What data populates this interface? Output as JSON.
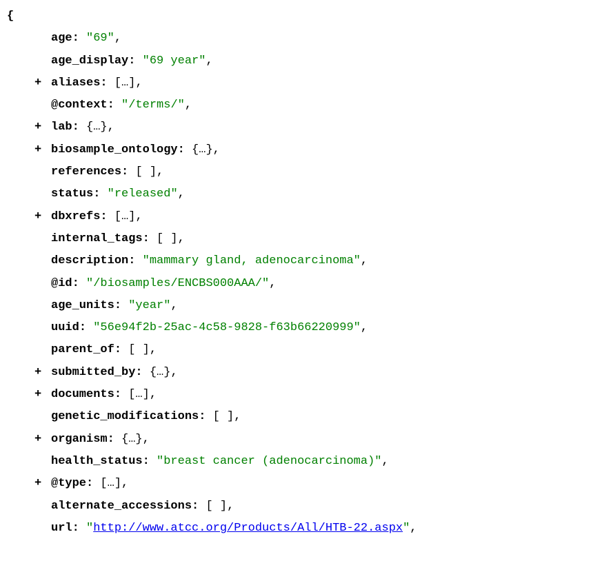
{
  "rows": [
    {
      "expandable": false,
      "key": "age",
      "type": "string",
      "value": "69"
    },
    {
      "expandable": false,
      "key": "age_display",
      "type": "string",
      "value": "69 year"
    },
    {
      "expandable": true,
      "key": "aliases",
      "type": "array_collapsed",
      "value": "[…]"
    },
    {
      "expandable": false,
      "key": "@context",
      "type": "string",
      "value": "/terms/"
    },
    {
      "expandable": true,
      "key": "lab",
      "type": "object_collapsed",
      "value": "{…}"
    },
    {
      "expandable": true,
      "key": "biosample_ontology",
      "type": "object_collapsed",
      "value": "{…}"
    },
    {
      "expandable": false,
      "key": "references",
      "type": "array_empty",
      "value": "[ ]"
    },
    {
      "expandable": false,
      "key": "status",
      "type": "string",
      "value": "released"
    },
    {
      "expandable": true,
      "key": "dbxrefs",
      "type": "array_collapsed",
      "value": "[…]"
    },
    {
      "expandable": false,
      "key": "internal_tags",
      "type": "array_empty",
      "value": "[ ]"
    },
    {
      "expandable": false,
      "key": "description",
      "type": "string",
      "value": "mammary gland, adenocarcinoma"
    },
    {
      "expandable": false,
      "key": "@id",
      "type": "string",
      "value": "/biosamples/ENCBS000AAA/"
    },
    {
      "expandable": false,
      "key": "age_units",
      "type": "string",
      "value": "year"
    },
    {
      "expandable": false,
      "key": "uuid",
      "type": "string",
      "value": "56e94f2b-25ac-4c58-9828-f63b66220999"
    },
    {
      "expandable": false,
      "key": "parent_of",
      "type": "array_empty",
      "value": "[ ]"
    },
    {
      "expandable": true,
      "key": "submitted_by",
      "type": "object_collapsed",
      "value": "{…}"
    },
    {
      "expandable": true,
      "key": "documents",
      "type": "array_collapsed",
      "value": "[…]"
    },
    {
      "expandable": false,
      "key": "genetic_modifications",
      "type": "array_empty",
      "value": "[ ]"
    },
    {
      "expandable": true,
      "key": "organism",
      "type": "object_collapsed",
      "value": "{…}"
    },
    {
      "expandable": false,
      "key": "health_status",
      "type": "string",
      "value": "breast cancer (adenocarcinoma)"
    },
    {
      "expandable": true,
      "key": "@type",
      "type": "array_collapsed",
      "value": "[…]"
    },
    {
      "expandable": false,
      "key": "alternate_accessions",
      "type": "array_empty",
      "value": "[ ]"
    },
    {
      "expandable": false,
      "key": "url",
      "type": "link",
      "value": "http://www.atcc.org/Products/All/HTB-22.aspx"
    }
  ],
  "open_brace": "{",
  "expand_symbol": "+",
  "quote": "\"",
  "colon_sep": ":",
  "comma": ","
}
